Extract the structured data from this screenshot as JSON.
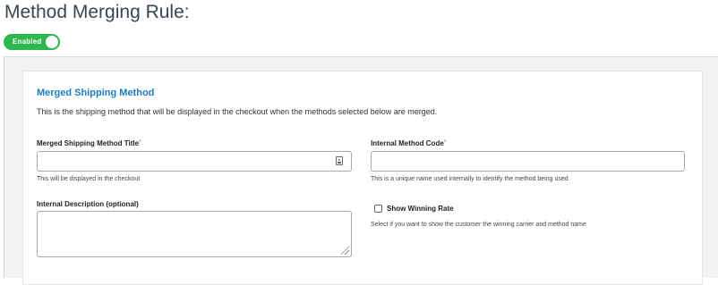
{
  "page": {
    "title": "Method Merging Rule:"
  },
  "toggle": {
    "label": "Enabled",
    "state": "on",
    "color": "#2db84d"
  },
  "section": {
    "title": "Merged Shipping Method",
    "description": "This is the shipping method that will be displayed in the checkout when the methods selected below are merged."
  },
  "fields": {
    "method_title": {
      "label": "Merged Shipping Method Title",
      "required_mark": "*",
      "value": "",
      "help": "This will be displayed in the checkout",
      "icon": "contact-card-icon"
    },
    "method_code": {
      "label": "Internal Method Code",
      "required_mark": "*",
      "value": "",
      "help": "This is a unique name used internally to identify the method being used"
    },
    "description": {
      "label": "Internal Description (optional)",
      "value": ""
    },
    "show_winning_rate": {
      "label": "Show Winning Rate",
      "checked": false,
      "help": "Select if you want to show the customer the winning carrier and method name"
    }
  },
  "colors": {
    "accent": "#1b7fc2",
    "required": "#d9534f",
    "title": "#3a4652"
  }
}
